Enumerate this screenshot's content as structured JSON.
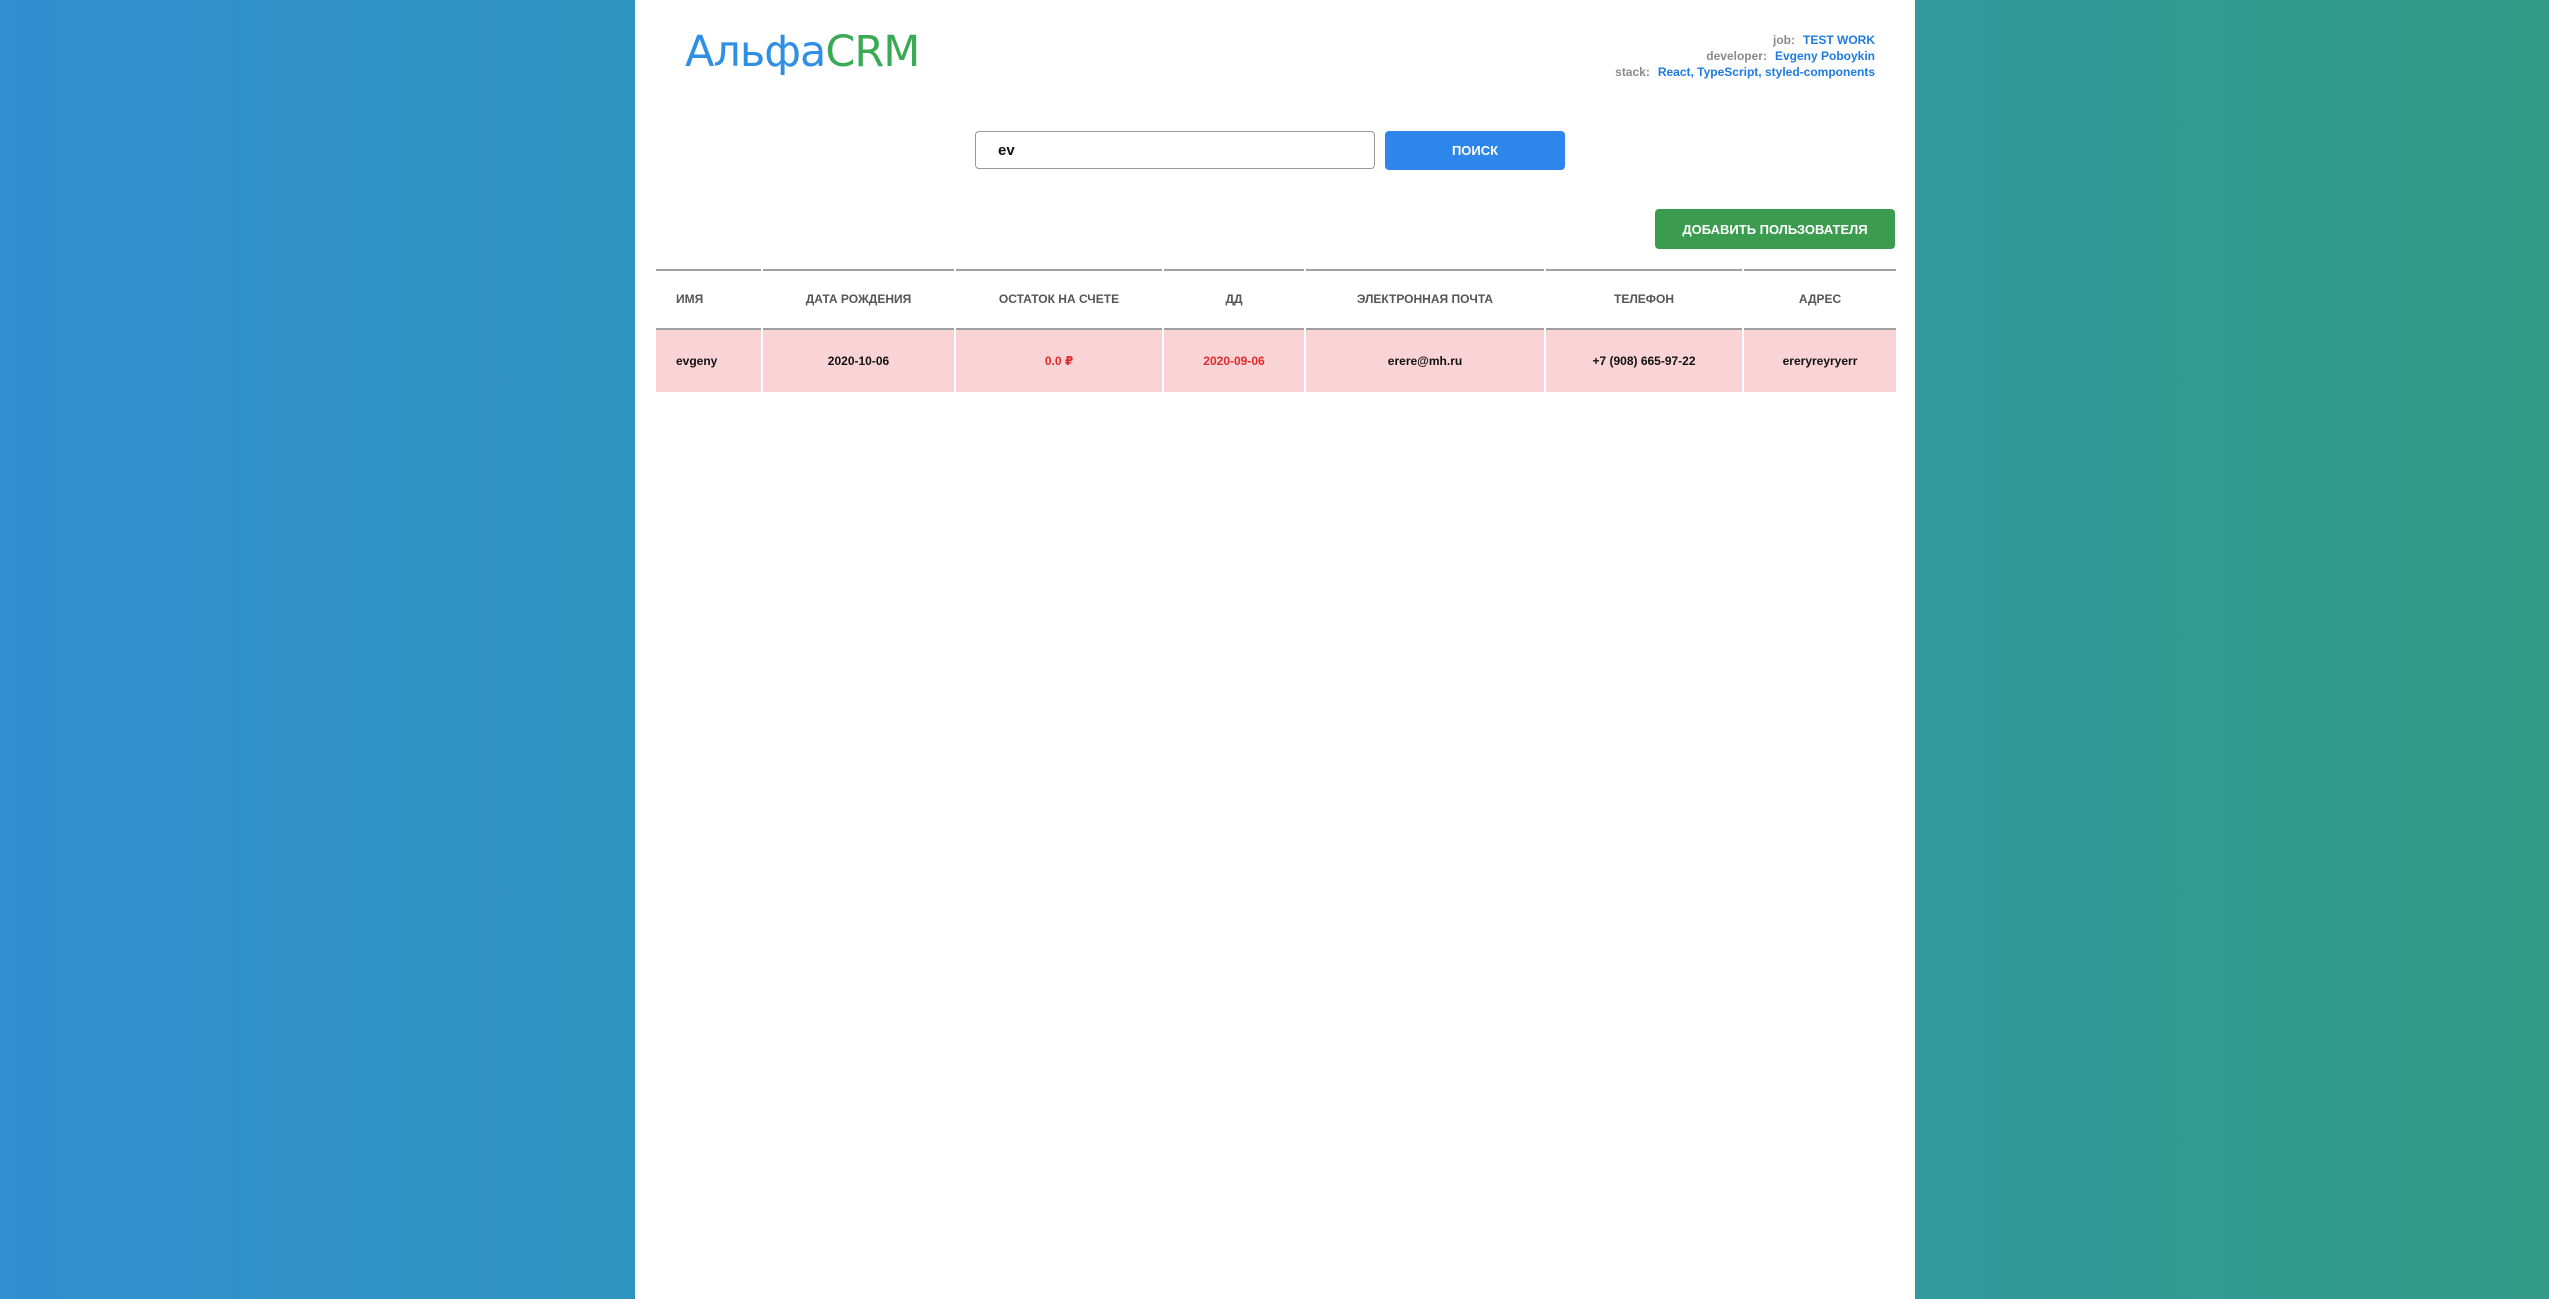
{
  "header": {
    "logo_part1": "Альфа",
    "logo_part2": "CRM",
    "meta": {
      "job_label": "job:",
      "job_value": "TEST WORK",
      "developer_label": "developer:",
      "developer_value": "Evgeny Poboykin",
      "stack_label": "stack:",
      "stack_value": "React, TypeScript, styled-components"
    }
  },
  "search": {
    "value": "ev",
    "button_label": "Поиск"
  },
  "actions": {
    "add_user_label": "Добавить пользователя"
  },
  "table": {
    "columns": [
      "Имя",
      "Дата рождения",
      "Остаток на счете",
      "ДД",
      "Электронная почта",
      "Телефон",
      "Адрес"
    ],
    "rows": [
      {
        "name": "evgeny",
        "birth_date": "2020-10-06",
        "balance": "0.0 ₽",
        "dd": "2020-09-06",
        "email": "erere@mh.ru",
        "phone": "+7 (908) 665-97-22",
        "address": "ereryreyryerr"
      }
    ]
  },
  "colors": {
    "logo_blue": "#2f8fe5",
    "logo_green": "#3aaa55",
    "search_button": "#2f86ea",
    "add_button": "#3b9c50",
    "row_background": "#f9d3d5",
    "alert_text": "#e12a2a"
  }
}
